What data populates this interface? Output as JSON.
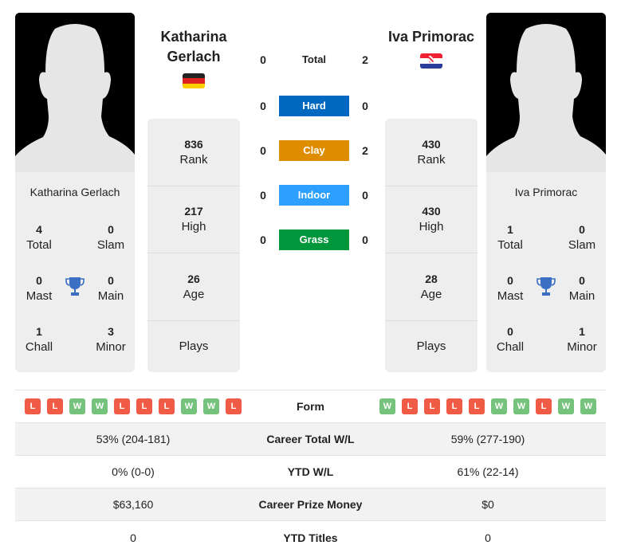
{
  "players": {
    "left": {
      "name": "Katharina Gerlach",
      "name_line1": "Katharina",
      "name_line2": "Gerlach",
      "flag": "germany",
      "flag_colors": [
        "#222222",
        "#dd2222",
        "#ffce00"
      ],
      "stats": [
        {
          "value": "836",
          "label": "Rank"
        },
        {
          "value": "217",
          "label": "High"
        },
        {
          "value": "26",
          "label": "Age"
        },
        {
          "value": "",
          "label": "Plays"
        }
      ],
      "titles": {
        "total": {
          "value": "4",
          "label": "Total"
        },
        "slam": {
          "value": "0",
          "label": "Slam"
        },
        "mast": {
          "value": "0",
          "label": "Mast"
        },
        "main": {
          "value": "0",
          "label": "Main"
        },
        "chall": {
          "value": "1",
          "label": "Chall"
        },
        "minor": {
          "value": "3",
          "label": "Minor"
        }
      },
      "form": [
        "L",
        "L",
        "W",
        "W",
        "L",
        "L",
        "L",
        "W",
        "W",
        "L"
      ]
    },
    "right": {
      "name": "Iva Primorac",
      "flag": "croatia",
      "flag_colors": [
        "#ee2233",
        "#ffffff",
        "#2a3d9a"
      ],
      "stats": [
        {
          "value": "430",
          "label": "Rank"
        },
        {
          "value": "430",
          "label": "High"
        },
        {
          "value": "28",
          "label": "Age"
        },
        {
          "value": "",
          "label": "Plays"
        }
      ],
      "titles": {
        "total": {
          "value": "1",
          "label": "Total"
        },
        "slam": {
          "value": "0",
          "label": "Slam"
        },
        "mast": {
          "value": "0",
          "label": "Mast"
        },
        "main": {
          "value": "0",
          "label": "Main"
        },
        "chall": {
          "value": "0",
          "label": "Chall"
        },
        "minor": {
          "value": "1",
          "label": "Minor"
        }
      },
      "form": [
        "W",
        "L",
        "L",
        "L",
        "L",
        "W",
        "W",
        "L",
        "W",
        "W"
      ]
    }
  },
  "h2h": [
    {
      "label": "Total",
      "left": "0",
      "right": "2",
      "color": null
    },
    {
      "label": "Hard",
      "left": "0",
      "right": "0",
      "color": "#0068c0"
    },
    {
      "label": "Clay",
      "left": "0",
      "right": "2",
      "color": "#df8d00"
    },
    {
      "label": "Indoor",
      "left": "0",
      "right": "0",
      "color": "#2d9ffe"
    },
    {
      "label": "Grass",
      "left": "0",
      "right": "0",
      "color": "#00963c"
    }
  ],
  "comparison": [
    {
      "label": "Form",
      "left": "",
      "right": ""
    },
    {
      "label": "Career Total W/L",
      "left": "53% (204-181)",
      "right": "59% (277-190)"
    },
    {
      "label": "YTD W/L",
      "left": "0% (0-0)",
      "right": "61% (22-14)"
    },
    {
      "label": "Career Prize Money",
      "left": "$63,160",
      "right": "$0"
    },
    {
      "label": "YTD Titles",
      "left": "0",
      "right": "0"
    }
  ],
  "colors": {
    "win": "#74c27b",
    "loss": "#ef5b45",
    "trophy": "#3a6fc4"
  }
}
